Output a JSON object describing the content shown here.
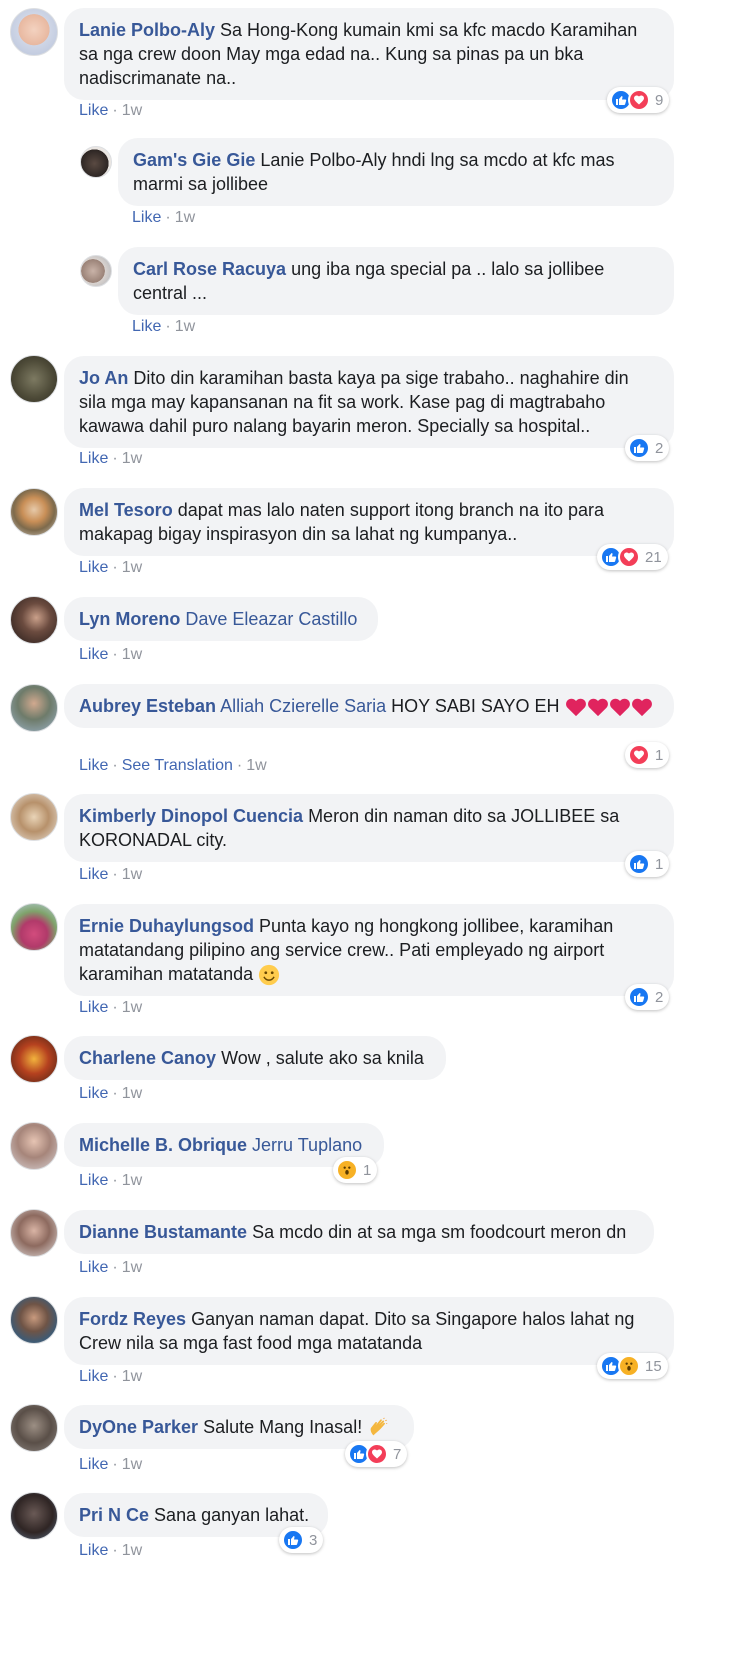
{
  "ui": {
    "like_label": "Like",
    "see_translation_label": "See Translation",
    "accent_color": "#385898",
    "like_color": "#1877f2",
    "love_color": "#f33e58",
    "wow_color": "#f7b125"
  },
  "comments": [
    {
      "name": "Lanie Polbo-Aly",
      "text": "Sa Hong-Kong kumain kmi sa kfc macdo Karamihan sa nga crew doon May mga edad na.. Kung sa pinas pa un bka nadiscrimanate na..",
      "time": "1w",
      "reactions": [
        "like",
        "love"
      ],
      "count": "9"
    },
    {
      "name": "Gam's Gie Gie",
      "mention": "",
      "text": "Lanie Polbo-Aly hndi lng sa mcdo at kfc mas marmi sa jollibee",
      "time": "1w",
      "reply": true
    },
    {
      "name": "Carl Rose Racuya",
      "text": "ung iba nga special pa .. lalo sa jollibee central ...",
      "time": "1w",
      "reply": true
    },
    {
      "name": "Jo An",
      "text": "Dito din karamihan basta kaya pa sige trabaho.. naghahire din sila mga may kapansanan na fit sa work. Kase pag di magtrabaho kawawa dahil puro nalang bayarin meron. Specially sa hospital..",
      "time": "1w",
      "reactions": [
        "like"
      ],
      "count": "2"
    },
    {
      "name": "Mel Tesoro",
      "text": "dapat mas lalo naten support itong branch na ito para makapag bigay inspirasyon din sa lahat ng kumpanya..",
      "time": "1w",
      "reactions": [
        "like",
        "love"
      ],
      "count": "21"
    },
    {
      "name": "Lyn Moreno",
      "mention": "Dave Eleazar Castillo",
      "text": "",
      "time": "1w"
    },
    {
      "name": "Aubrey Esteban",
      "mention": "Alliah Czierelle Saria",
      "text": "HOY SABI SAYO EH",
      "time": "1w",
      "reactions": [
        "love"
      ],
      "count": "1",
      "translation": true
    },
    {
      "name": "Kimberly Dinopol Cuencia",
      "text": "Meron din naman dito sa JOLLIBEE sa KORONADAL city.",
      "time": "1w",
      "reactions": [
        "like"
      ],
      "count": "1"
    },
    {
      "name": "Ernie Duhaylungsod",
      "text": "Punta kayo ng hongkong jollibee, karamihan matatandang pilipino ang service crew.. Pati empleyado ng airport karamihan matatanda",
      "time": "1w",
      "reactions": [
        "like"
      ],
      "count": "2"
    },
    {
      "name": "Charlene Canoy",
      "text": "Wow , salute ako sa knila",
      "time": "1w"
    },
    {
      "name": "Michelle B. Obrique",
      "mention": "Jerru Tuplano",
      "text": "",
      "time": "1w",
      "reactions": [
        "wow"
      ],
      "count": "1"
    },
    {
      "name": "Dianne Bustamante",
      "text": "Sa mcdo din at sa mga sm foodcourt meron dn",
      "time": "1w"
    },
    {
      "name": "Fordz Reyes",
      "text": "Ganyan naman dapat. Dito sa Singapore halos lahat ng Crew nila sa mga fast food mga matatanda",
      "time": "1w",
      "reactions": [
        "like",
        "wow"
      ],
      "count": "15"
    },
    {
      "name": "DyOne Parker",
      "text": "Salute Mang Inasal!",
      "time": "1w",
      "reactions": [
        "like",
        "love"
      ],
      "count": "7"
    },
    {
      "name": "Pri N Ce",
      "text": "Sana ganyan lahat.",
      "time": "1w",
      "reactions": [
        "like"
      ],
      "count": "3"
    }
  ]
}
